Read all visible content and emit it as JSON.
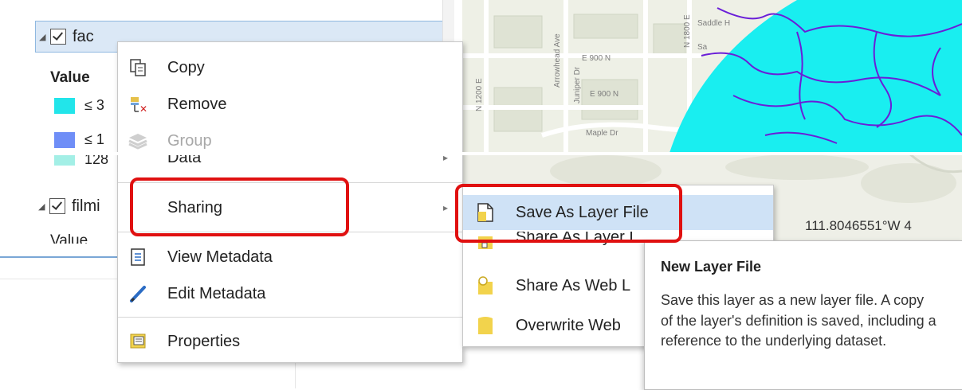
{
  "contents_pane": {
    "layers": [
      {
        "name": "fac",
        "checked": true,
        "selected": true
      },
      {
        "name": "filmi",
        "checked": true,
        "selected": false
      }
    ],
    "value_label_1": "Value",
    "value_label_2": "Value",
    "legend": [
      {
        "label": "≤ 3",
        "color": "#22e5ea"
      },
      {
        "label": "≤ 1",
        "color": "#6f8ef7"
      },
      {
        "label": "128",
        "color": "#a3efe6"
      }
    ]
  },
  "map": {
    "coordinate": "111.8046551°W 4",
    "street_labels": [
      "E 900 N",
      "E 900 N",
      "Maple Dr",
      "N 1200 E",
      "Arrowhead Ave",
      "Juniper Dr",
      "N 1800 E",
      "Saddle H",
      "Sa"
    ],
    "colors": {
      "flow_fill": "#19eef0",
      "stream": "#6a1ed8",
      "base": "#eef0e6"
    }
  },
  "context_menu": {
    "items": [
      {
        "label": "Copy",
        "icon": "copy-icon",
        "enabled": true
      },
      {
        "label": "Remove",
        "icon": "remove-icon",
        "enabled": true
      },
      {
        "label": "Group",
        "icon": "group-icon",
        "enabled": false
      },
      {
        "label": "Data",
        "icon": "",
        "enabled": true,
        "has_submenu": true
      },
      {
        "label": "Sharing",
        "icon": "",
        "enabled": true,
        "has_submenu": true
      },
      {
        "label": "View Metadata",
        "icon": "view-metadata-icon",
        "enabled": true
      },
      {
        "label": "Edit Metadata",
        "icon": "edit-metadata-icon",
        "enabled": true
      },
      {
        "label": "Properties",
        "icon": "properties-icon",
        "enabled": true
      }
    ]
  },
  "sharing_submenu": {
    "items": [
      {
        "label": "Save As Layer File",
        "icon": "layer-file-icon",
        "highlighted": true
      },
      {
        "label": "Share As Layer I",
        "icon": "share-layer-icon",
        "highlighted": false
      },
      {
        "label": "Share As Web L",
        "icon": "share-web-layer-icon",
        "highlighted": false
      },
      {
        "label": "Overwrite Web",
        "icon": "overwrite-web-icon",
        "highlighted": false
      }
    ]
  },
  "tooltip": {
    "title": "New Layer File",
    "description": "Save this layer as a new layer file. A copy of the layer's definition is saved, including a reference to the underlying dataset."
  },
  "colors": {
    "highlight_box": "#e01010",
    "menu_hover": "#cfe2f6",
    "selection": "#dbe8f6"
  }
}
